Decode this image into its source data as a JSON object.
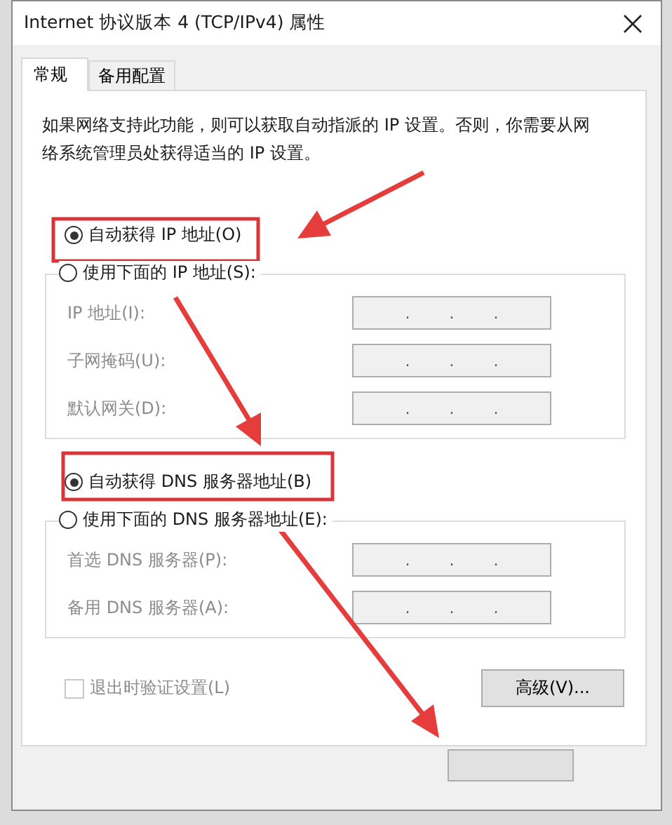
{
  "window": {
    "title": "Internet 协议版本 4 (TCP/IPv4) 属性"
  },
  "tabs": [
    {
      "label": "常规",
      "selected": true
    },
    {
      "label": "备用配置",
      "selected": false
    }
  ],
  "description": "如果网络支持此功能，则可以获取自动指派的 IP 设置。否则，你需要从网络系统管理员处获得适当的 IP 设置。",
  "ip_mode": [
    {
      "label": "自动获得 IP 地址(O)",
      "selected": true
    },
    {
      "label": "使用下面的 IP 地址(S):",
      "selected": false
    }
  ],
  "ip_fields": [
    {
      "label": "IP 地址(I):",
      "disabled": true,
      "separators": [
        ".",
        ".",
        "."
      ]
    },
    {
      "label": "子网掩码(U):",
      "disabled": true,
      "separators": [
        ".",
        ".",
        "."
      ]
    },
    {
      "label": "默认网关(D):",
      "disabled": true,
      "separators": [
        ".",
        ".",
        "."
      ]
    }
  ],
  "dns_mode": [
    {
      "label": "自动获得 DNS 服务器地址(B)",
      "selected": true
    },
    {
      "label": "使用下面的 DNS 服务器地址(E):",
      "selected": false
    }
  ],
  "dns_fields": [
    {
      "label": "首选 DNS 服务器(P):",
      "disabled": true,
      "separators": [
        ".",
        ".",
        "."
      ]
    },
    {
      "label": "备用 DNS 服务器(A):",
      "disabled": true,
      "separators": [
        ".",
        ".",
        "."
      ]
    }
  ],
  "validate": {
    "label": "退出时验证设置(L)",
    "checked": false,
    "disabled": true
  },
  "advanced_button": "高级(V)..."
}
